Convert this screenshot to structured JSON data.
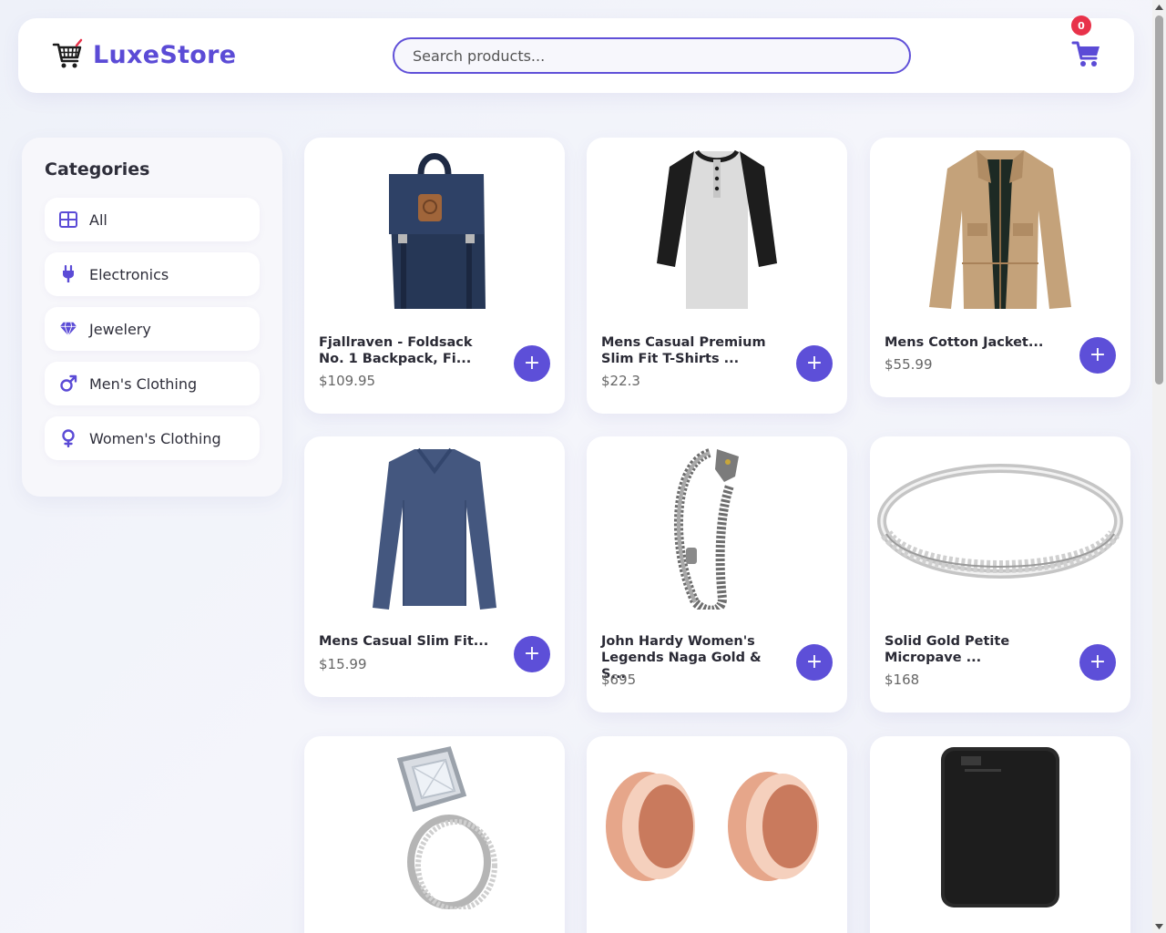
{
  "brand": {
    "name": "LuxeStore",
    "accent": "#5b4bd6"
  },
  "search": {
    "placeholder": "Search products..."
  },
  "cart": {
    "count": "0"
  },
  "sidebar": {
    "title": "Categories",
    "items": [
      {
        "label": "All",
        "icon": "grid-icon"
      },
      {
        "label": "Electronics",
        "icon": "plug-icon"
      },
      {
        "label": "Jewelery",
        "icon": "gem-icon"
      },
      {
        "label": "Men's Clothing",
        "icon": "mars-icon"
      },
      {
        "label": "Women's Clothing",
        "icon": "venus-icon"
      }
    ]
  },
  "products": [
    {
      "name": "Fjallraven - Foldsack No. 1 Backpack, Fi...",
      "price": "$109.95",
      "add_label": "+",
      "image": "backpack"
    },
    {
      "name": "Mens Casual Premium Slim Fit T-Shirts ...",
      "price": "$22.3",
      "add_label": "+",
      "image": "henley-shirt"
    },
    {
      "name": "Mens Cotton Jacket...",
      "price": "$55.99",
      "add_label": "+",
      "image": "cotton-jacket"
    },
    {
      "name": "Mens Casual Slim Fit...",
      "price": "$15.99",
      "add_label": "+",
      "image": "long-sleeve-shirt"
    },
    {
      "name": "John Hardy Women's Legends Naga Gold & S...",
      "price": "$695",
      "add_label": "+",
      "image": "dragon-bracelet"
    },
    {
      "name": "Solid Gold Petite Micropave ...",
      "price": "$168",
      "add_label": "+",
      "image": "silver-band-ring"
    },
    {
      "name": "",
      "price": "",
      "add_label": "",
      "image": "halo-ring-set"
    },
    {
      "name": "",
      "price": "",
      "add_label": "",
      "image": "rose-gold-plugs"
    },
    {
      "name": "",
      "price": "",
      "add_label": "",
      "image": "external-hard-drive"
    }
  ]
}
